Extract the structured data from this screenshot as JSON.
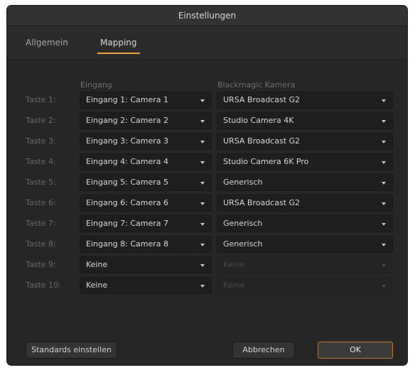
{
  "window": {
    "title": "Einstellungen"
  },
  "tabs": [
    {
      "label": "Allgemein",
      "active": false
    },
    {
      "label": "Mapping",
      "active": true
    }
  ],
  "columns": {
    "input": "Eingang",
    "camera": "Blackmagic Kamera"
  },
  "rows": [
    {
      "label": "Taste 1:",
      "input": "Eingang 1: Camera 1",
      "camera": "URSA Broadcast G2",
      "camera_enabled": true
    },
    {
      "label": "Taste 2:",
      "input": "Eingang 2: Camera 2",
      "camera": "Studio Camera 4K",
      "camera_enabled": true
    },
    {
      "label": "Taste 3:",
      "input": "Eingang 3: Camera 3",
      "camera": "URSA Broadcast G2",
      "camera_enabled": true
    },
    {
      "label": "Taste 4:",
      "input": "Eingang 4: Camera 4",
      "camera": "Studio Camera 6K Pro",
      "camera_enabled": true
    },
    {
      "label": "Taste 5:",
      "input": "Eingang 5: Camera 5",
      "camera": "Generisch",
      "camera_enabled": true
    },
    {
      "label": "Taste 6:",
      "input": "Eingang 6: Camera 6",
      "camera": "URSA Broadcast G2",
      "camera_enabled": true
    },
    {
      "label": "Taste 7:",
      "input": "Eingang 7: Camera 7",
      "camera": "Generisch",
      "camera_enabled": true
    },
    {
      "label": "Taste 8:",
      "input": "Eingang 8: Camera 8",
      "camera": "Generisch",
      "camera_enabled": true
    },
    {
      "label": "Taste 9:",
      "input": "Keine",
      "camera": "Keine",
      "camera_enabled": false
    },
    {
      "label": "Taste 10:",
      "input": "Keine",
      "camera": "Keine",
      "camera_enabled": false
    }
  ],
  "buttons": {
    "defaults": "Standards einstellen",
    "cancel": "Abbrechen",
    "ok": "OK"
  },
  "colors": {
    "accent": "#f2a33b",
    "ok_border": "#c57a2c",
    "background": "#262626"
  }
}
